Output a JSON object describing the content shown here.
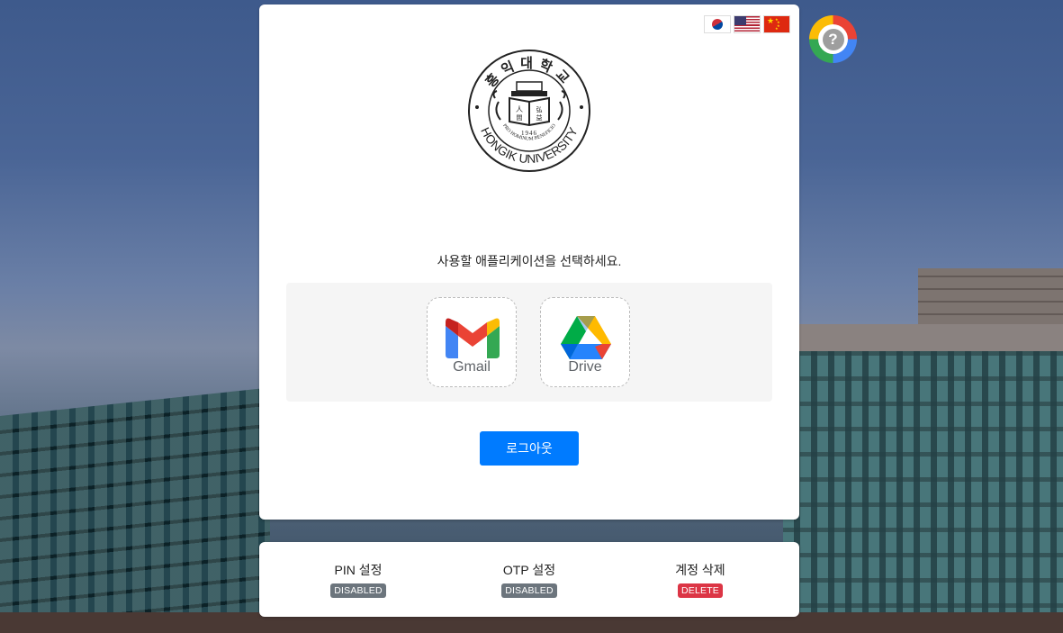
{
  "languages": [
    {
      "name": "Korean",
      "icon": "korea-flag-icon"
    },
    {
      "name": "English",
      "icon": "us-flag-icon"
    },
    {
      "name": "Chinese",
      "icon": "china-flag-icon"
    }
  ],
  "help": {
    "icon": "help-question-icon",
    "glyph": "?"
  },
  "logo": {
    "icon": "hongik-university-seal",
    "korean_name": "홍익대학교",
    "english_name": "HONGIK UNIVERSITY",
    "motto": "PRO HOMINUM BENEFICIO",
    "year": "1946"
  },
  "prompt": "사용할 애플리케이션을 선택하세요.",
  "apps": [
    {
      "label": "Gmail",
      "icon": "gmail-icon"
    },
    {
      "label": "Drive",
      "icon": "google-drive-icon"
    }
  ],
  "logout_label": "로그아웃",
  "settings": [
    {
      "title": "PIN 설정",
      "badge": "DISABLED",
      "badge_color": "#6c757d"
    },
    {
      "title": "OTP 설정",
      "badge": "DISABLED",
      "badge_color": "#6c757d"
    },
    {
      "title": "계정 삭제",
      "badge": "DELETE",
      "badge_color": "#dc3545"
    }
  ]
}
